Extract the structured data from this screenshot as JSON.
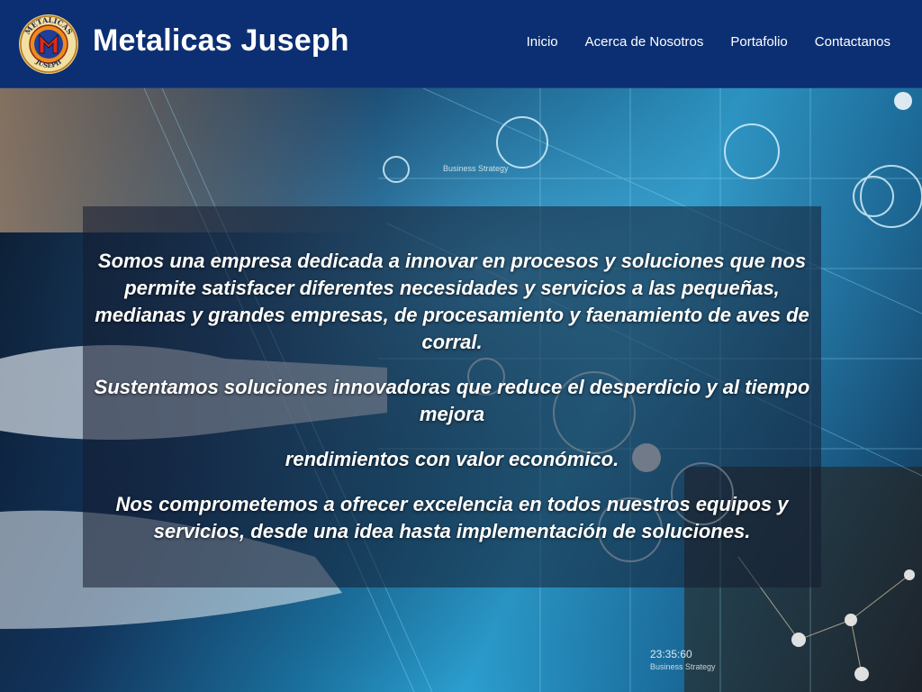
{
  "logo": {
    "top_text": "METALICAS",
    "bottom_text": "JUSEPH"
  },
  "brand": {
    "title": "Metalicas Juseph"
  },
  "nav": {
    "items": [
      {
        "label": "Inicio"
      },
      {
        "label": "Acerca de Nosotros"
      },
      {
        "label": "Portafolio"
      },
      {
        "label": "Contactanos"
      }
    ]
  },
  "hero": {
    "paragraphs": [
      "Somos una empresa dedicada a innovar en procesos y soluciones que nos permite satisfacer diferentes necesidades y servicios a las pequeñas, medianas y grandes empresas, de procesamiento y faenamiento de aves de corral.",
      "Sustentamos soluciones innovadoras que reduce el desperdicio y al tiempo mejora",
      "rendimientos con valor económico.",
      "Nos comprometemos a ofrecer excelencia en todos nuestros equipos y servicios, desde una idea hasta implementación de soluciones."
    ],
    "background_labels": {
      "strategy": "Business Strategy",
      "time": "23:35:60"
    }
  },
  "colors": {
    "navbar": "#0c2f73",
    "text": "#ffffff",
    "logo_ring": "#c8902a",
    "logo_inner": "#1f3e9a",
    "logo_accent": "#d92b1f"
  }
}
